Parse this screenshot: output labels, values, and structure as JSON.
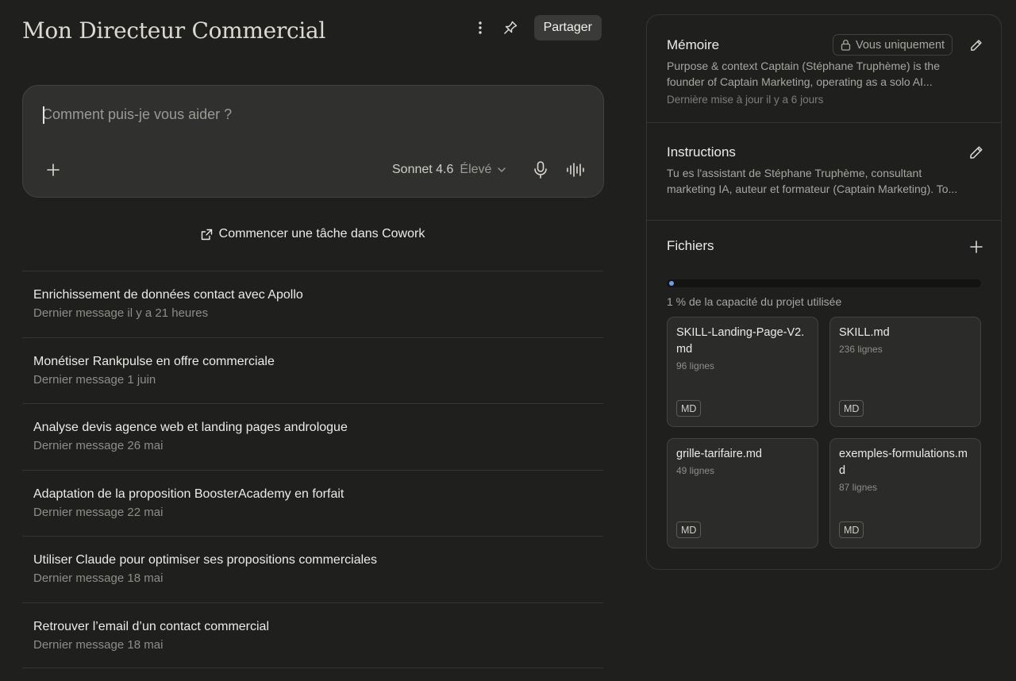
{
  "project": {
    "title": "Mon Directeur Commercial",
    "share_label": "Partager",
    "more_icon": "vertical-dots-icon",
    "pin_icon": "pin-icon"
  },
  "composer": {
    "placeholder": "Comment puis-je vous aider ?",
    "value": "",
    "model": "Sonnet 4.6",
    "effort": "Élevé"
  },
  "cowork": {
    "label": "Commencer une tâche dans Cowork"
  },
  "conversations": [
    {
      "title": "Enrichissement de données contact avec Apollo",
      "meta": "Dernier message il y a 21 heures"
    },
    {
      "title": "Monétiser Rankpulse en offre commerciale",
      "meta": "Dernier message 1 juin"
    },
    {
      "title": "Analyse devis agence web et landing pages andrologue",
      "meta": "Dernier message 26 mai"
    },
    {
      "title": "Adaptation de la proposition BoosterAcademy en forfait",
      "meta": "Dernier message 22 mai"
    },
    {
      "title": "Utiliser Claude pour optimiser ses propositions commerciales",
      "meta": "Dernier message 18 mai"
    },
    {
      "title": "Retrouver l’email d’un contact commercial",
      "meta": "Dernier message 18 mai"
    }
  ],
  "memory": {
    "title": "Mémoire",
    "privacy": "Vous uniquement",
    "text_line1": "Purpose & context Captain (Stéphane Truphème) is the",
    "text_line2": "founder of Captain Marketing, operating as a solo AI...",
    "updated": "Dernière mise à jour il y a 6 jours"
  },
  "instructions": {
    "title": "Instructions",
    "text_line1": "Tu es l'assistant de Stéphane Truphème, consultant",
    "text_line2": "marketing IA, auteur et formateur (Captain Marketing). To..."
  },
  "files": {
    "title": "Fichiers",
    "usage_label": "1 % de la capacité du projet utilisée",
    "usage_fraction": 0.01,
    "accent_color": "#6f9ce8",
    "items": [
      {
        "name": "SKILL-Landing-Page-V2.md",
        "lines": "96 lignes",
        "badge": "MD"
      },
      {
        "name": "SKILL.md",
        "lines": "236 lignes",
        "badge": "MD"
      },
      {
        "name": "grille-tarifaire.md",
        "lines": "49 lignes",
        "badge": "MD"
      },
      {
        "name": "exemples-formulations.md",
        "lines": "87 lignes",
        "badge": "MD"
      }
    ]
  }
}
